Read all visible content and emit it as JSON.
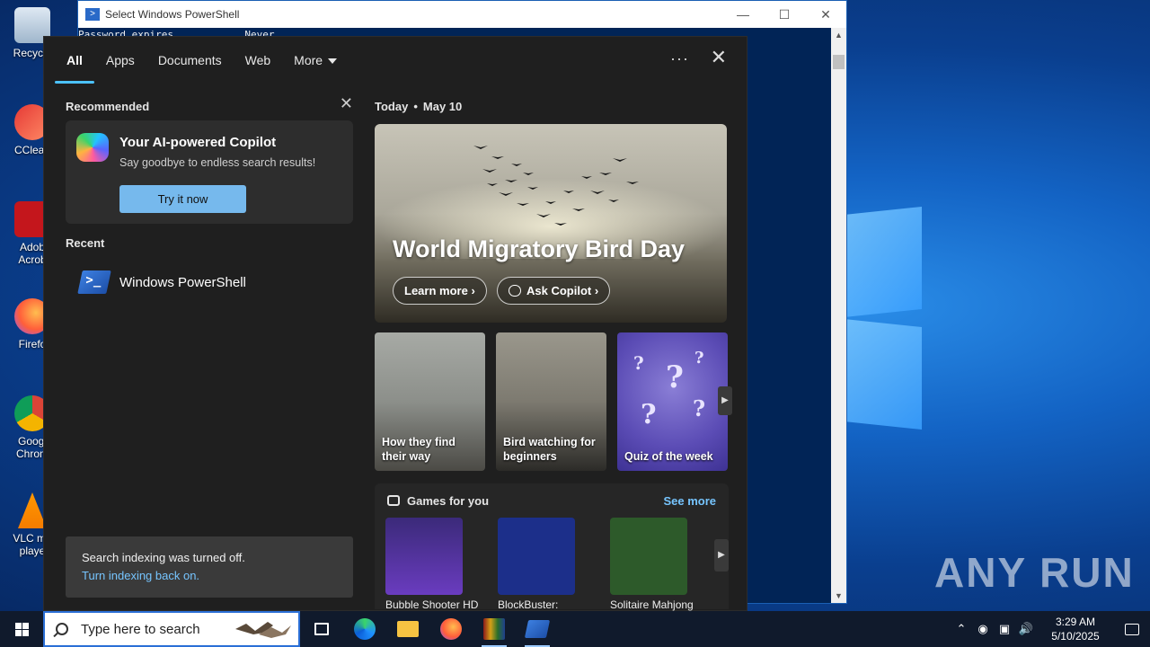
{
  "desktop": {
    "icons": [
      {
        "label": "Recycle"
      },
      {
        "label": "CClean"
      },
      {
        "label": "Adob Acrob"
      },
      {
        "label": "Firefo"
      },
      {
        "label": "Googl Chrom"
      },
      {
        "label": "VLC me playe"
      }
    ],
    "watermark": "ANY RUN"
  },
  "powershell": {
    "title": "Select Windows PowerShell",
    "line1": "Password expires            Never"
  },
  "search_panel": {
    "tabs": [
      {
        "label": "All"
      },
      {
        "label": "Apps"
      },
      {
        "label": "Documents"
      },
      {
        "label": "Web"
      },
      {
        "label": "More"
      }
    ],
    "recommended": {
      "heading": "Recommended",
      "copilot_title": "Your AI-powered Copilot",
      "copilot_subtitle": "Say goodbye to endless search results!",
      "try_button": "Try it now"
    },
    "recent": {
      "heading": "Recent",
      "items": [
        {
          "label": "Windows PowerShell"
        }
      ]
    },
    "indexing": {
      "message": "Search indexing was turned off.",
      "link": "Turn indexing back on."
    },
    "today": {
      "label": "Today",
      "date": "May 10",
      "hero_title": "World Migratory Bird Day",
      "learn_more": "Learn more",
      "ask_copilot": "Ask Copilot"
    },
    "cards": [
      {
        "label": "How they find their way"
      },
      {
        "label": "Bird watching for beginners"
      },
      {
        "label": "Quiz of the week"
      }
    ],
    "games": {
      "heading": "Games for you",
      "see_more": "See more",
      "items": [
        {
          "label": "Bubble Shooter HD"
        },
        {
          "label": "BlockBuster:"
        },
        {
          "label": "Solitaire Mahjong"
        }
      ]
    }
  },
  "taskbar": {
    "search_placeholder": "Type here to search",
    "time": "3:29 AM",
    "date": "5/10/2025"
  },
  "colors": {
    "accent": "#4cc2ff",
    "link": "#76c5ff",
    "button": "#76b9ed",
    "panel_bg": "#1f1f1f"
  }
}
